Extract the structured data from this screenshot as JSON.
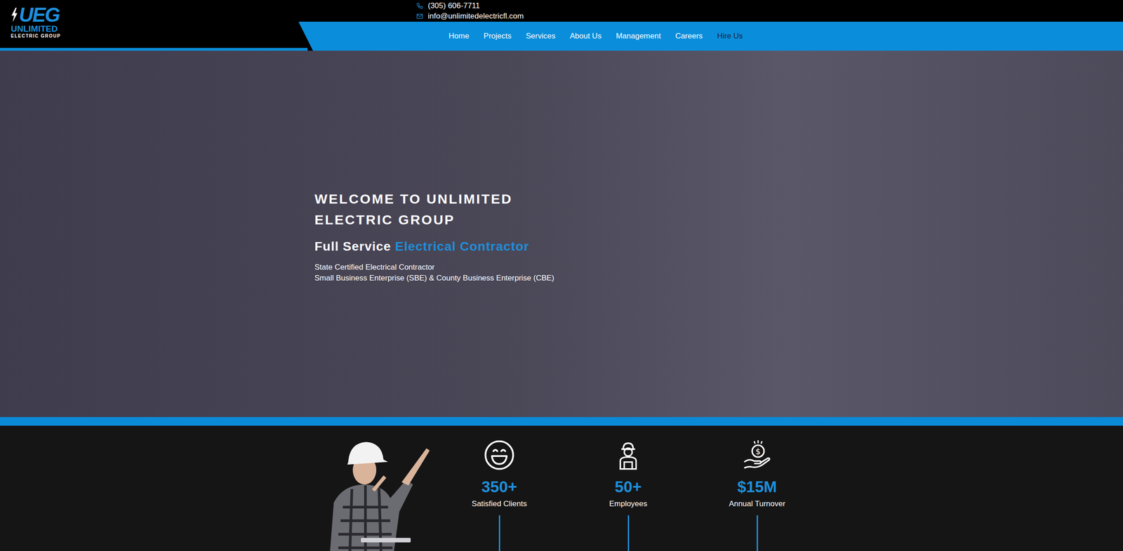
{
  "logo": {
    "mark": "UEG",
    "name": "UNLIMITED",
    "tagline": "ELECTRIC GROUP"
  },
  "contact": {
    "phone": "(305) 606-7711",
    "email": "info@unlimitedelectricfl.com"
  },
  "nav": [
    {
      "label": "Home",
      "kind": "link"
    },
    {
      "label": "Projects",
      "kind": "link"
    },
    {
      "label": "Services",
      "kind": "link"
    },
    {
      "label": "About Us",
      "kind": "link"
    },
    {
      "label": "Management",
      "kind": "link"
    },
    {
      "label": "Careers",
      "kind": "link"
    },
    {
      "label": "Hire Us",
      "kind": "cta"
    }
  ],
  "hero": {
    "title_lines": [
      "WELCOME TO UNLIMITED",
      "ELECTRIC GROUP"
    ],
    "lead": "Full Service",
    "highlight": "Electrical Contractor",
    "notes": [
      "State Certified Electrical Contractor",
      "Small Business Enterprise (SBE) & County Business Enterprise (CBE)"
    ]
  },
  "stats": [
    {
      "value": "350+",
      "label": "Satisfied Clients"
    },
    {
      "value": "50+",
      "label": "Employees"
    },
    {
      "value": "$15M",
      "label": "Annual Turnover"
    }
  ]
}
